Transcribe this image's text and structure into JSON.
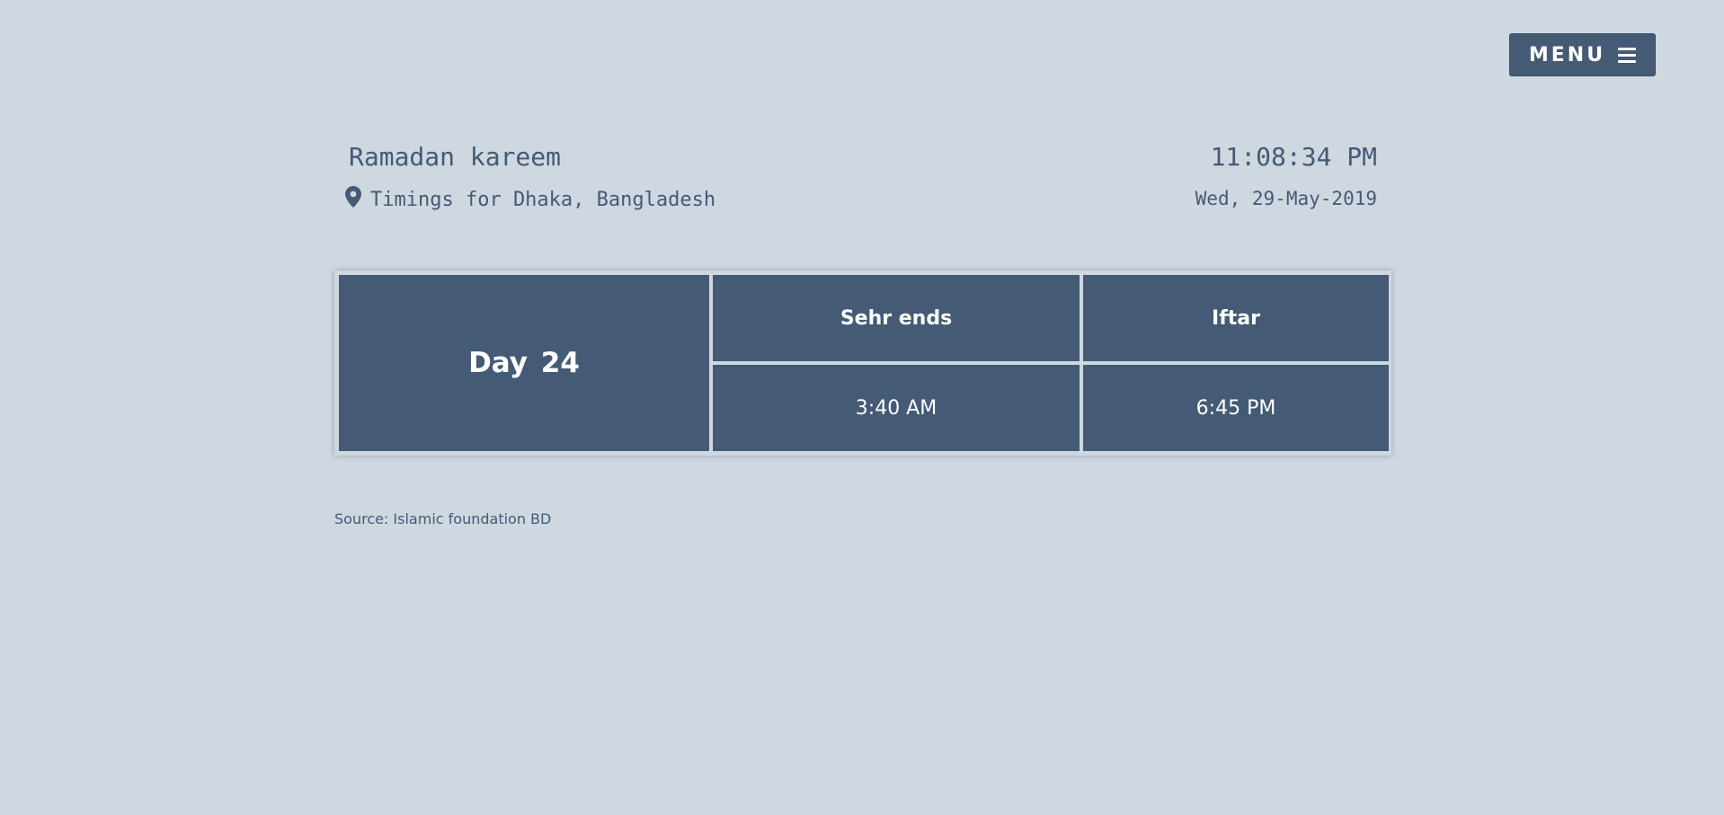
{
  "header": {
    "menu_label": "MENU",
    "menu_icon": "hamburger-icon"
  },
  "intro": {
    "greeting": "Ramadan kareem",
    "location_icon": "map-pin-icon",
    "location_text": "Timings for Dhaka, Bangladesh"
  },
  "clock": {
    "time": "11:08:34 PM",
    "date": "Wed, 29-May-2019"
  },
  "timetable": {
    "day": "Day 24",
    "columns": [
      "Sehr ends",
      "Iftar"
    ],
    "values": [
      "3:40 AM",
      "6:45 PM"
    ]
  },
  "footer": {
    "source": "Source: Islamic foundation BD"
  },
  "colors": {
    "background": "#cfd8e1",
    "accent": "#445a75",
    "text_on_accent": "#ffffff"
  }
}
